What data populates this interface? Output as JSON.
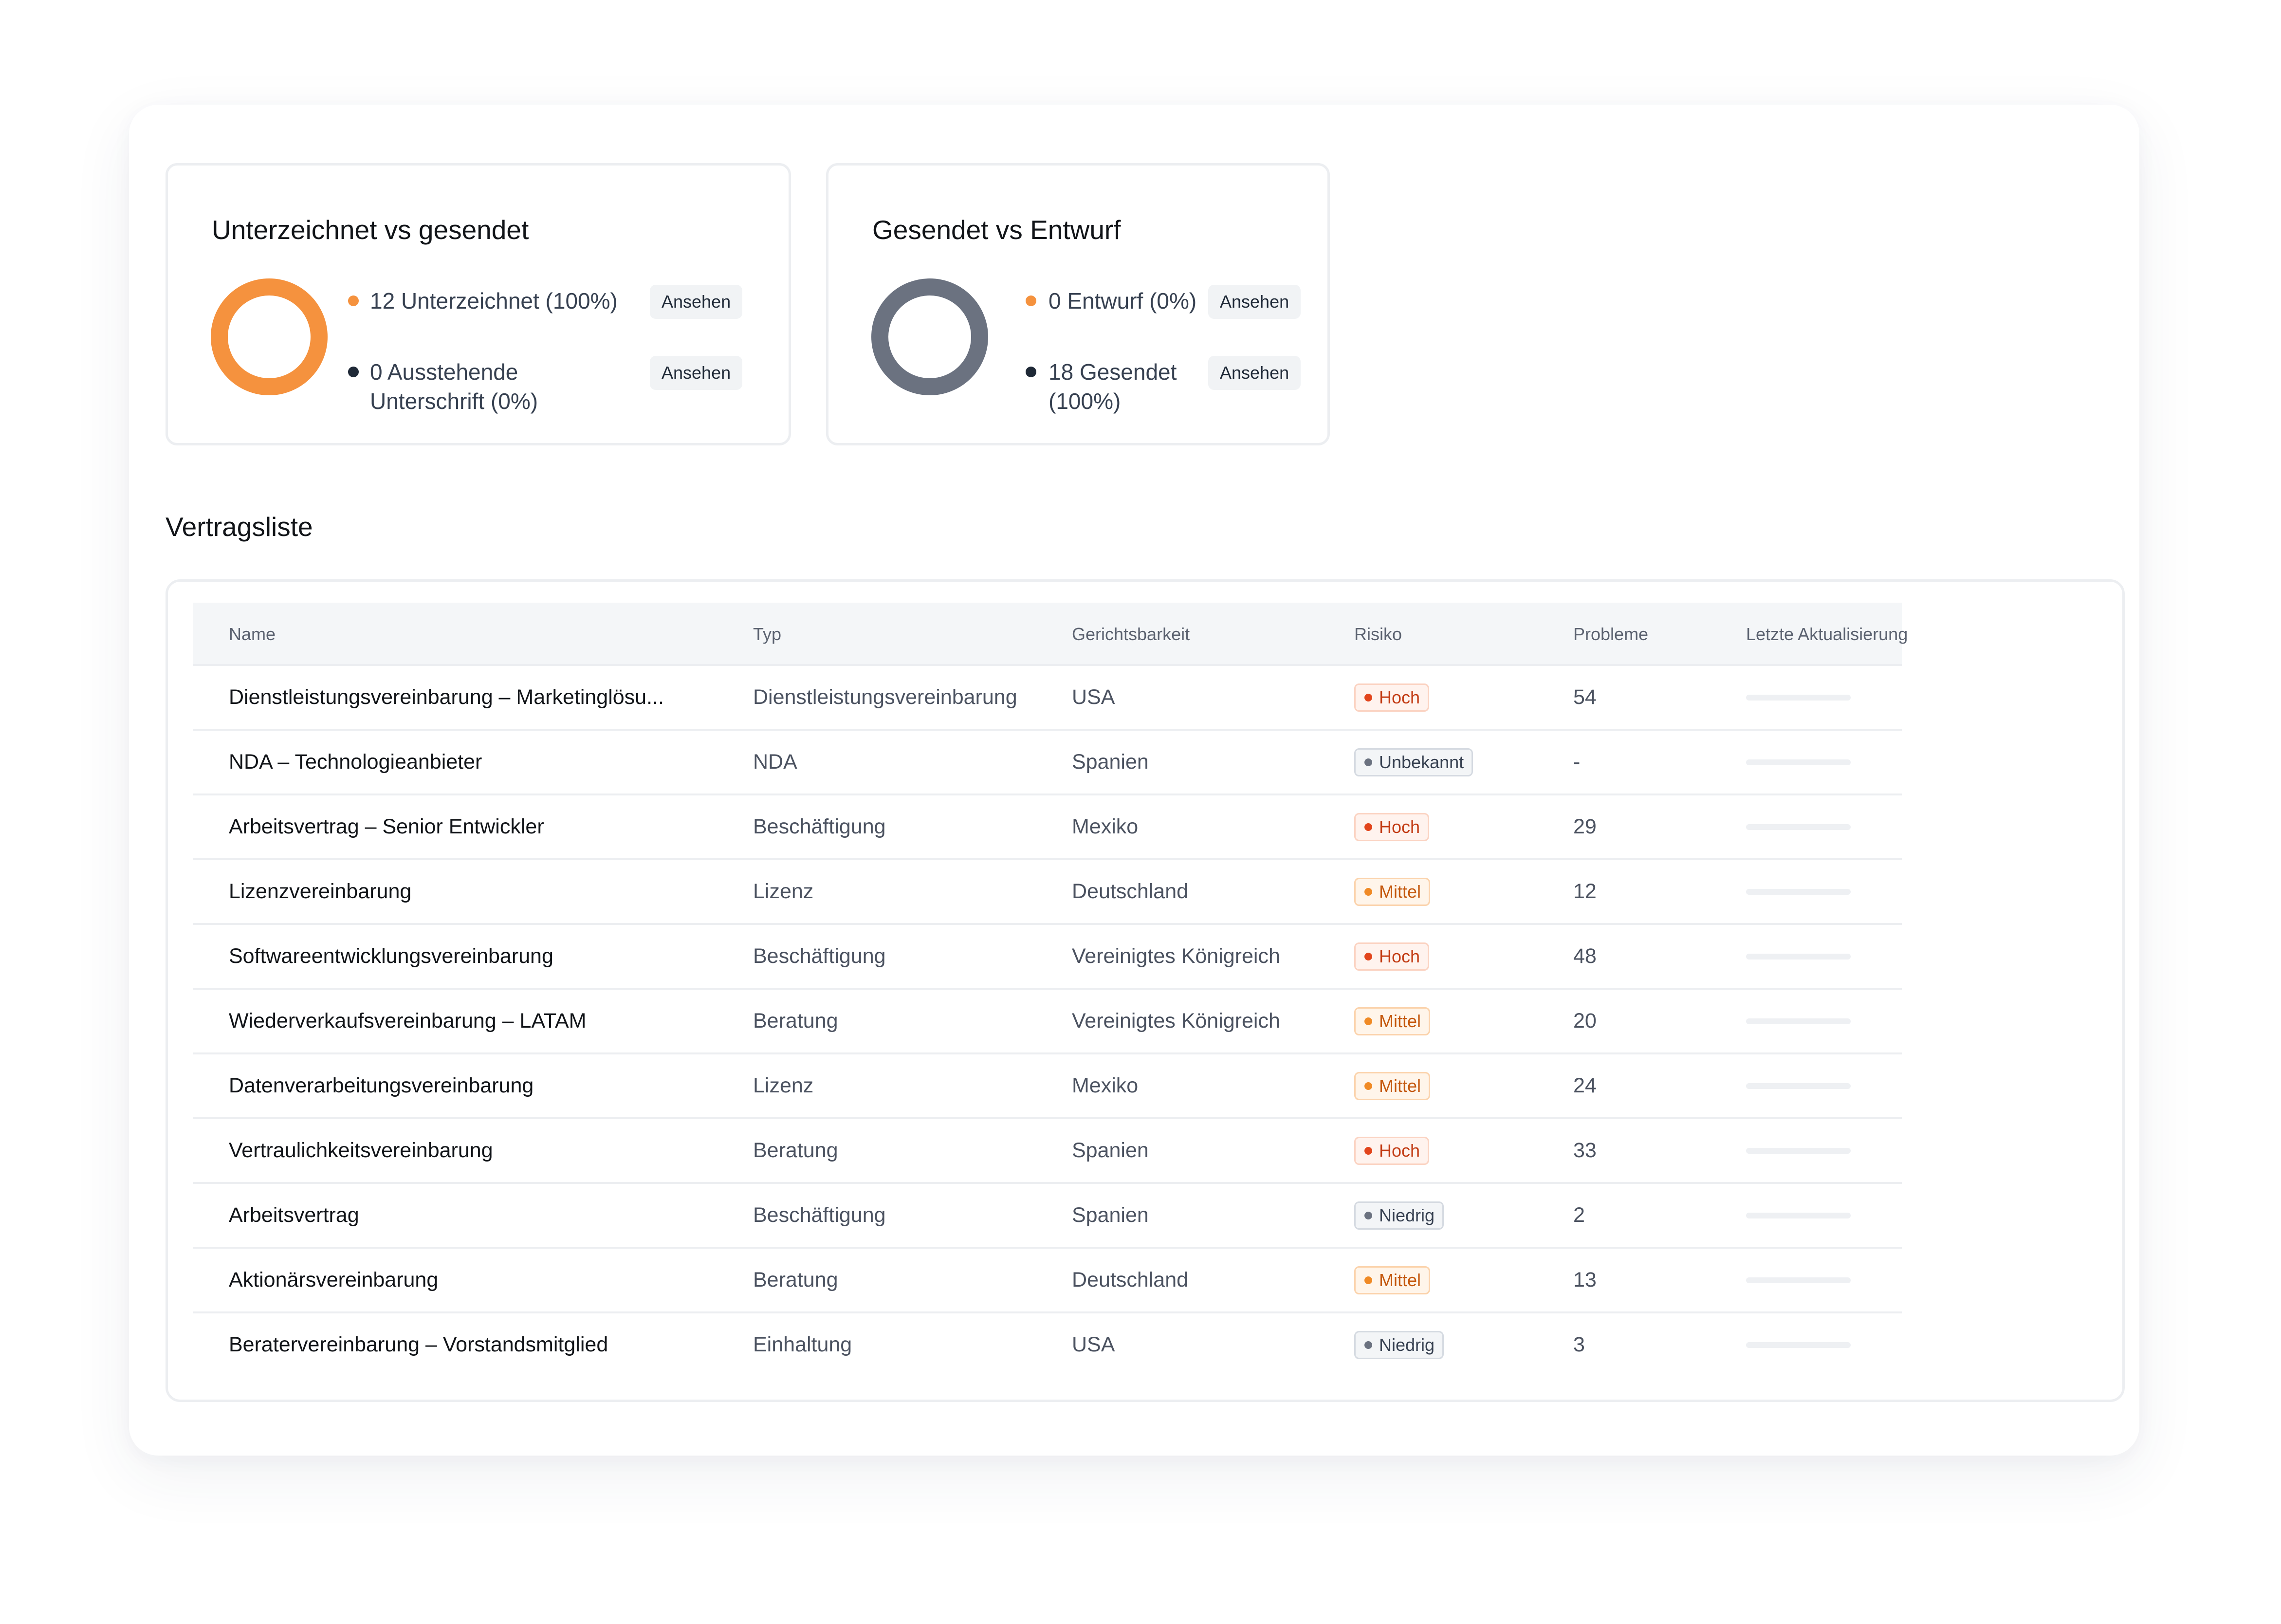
{
  "colors": {
    "accent_orange": "#f5923e",
    "gray_donut": "#6b7280",
    "dark_dot": "#1f2937",
    "risk_high": "#e2451c",
    "risk_medium": "#f08a25",
    "risk_neutral": "#6b7280"
  },
  "card_signed": {
    "title": "Unterzeichnet vs gesendet",
    "legend": [
      {
        "text": "12 Unterzeichnet (100%)",
        "button": "Ansehen",
        "color": "#f5923e"
      },
      {
        "text_line1": "0 Ausstehende",
        "text_line2": "Unterschrift (0%)",
        "button": "Ansehen",
        "color": "#1f2937"
      }
    ]
  },
  "card_sent": {
    "title": "Gesendet vs Entwurf",
    "legend": [
      {
        "text": "0 Entwurf (0%)",
        "button": "Ansehen",
        "color": "#f5923e"
      },
      {
        "text_line1": "18 Gesendet",
        "text_line2": "(100%)",
        "button": "Ansehen",
        "color": "#1f2937"
      }
    ]
  },
  "contracts": {
    "title": "Vertragsliste",
    "columns": [
      "Name",
      "Typ",
      "Gerichtsbarkeit",
      "Risiko",
      "Probleme",
      "Letzte Aktualisierung"
    ],
    "rows": [
      {
        "name": "Dienstleistungsvereinbarung – Marketinglösu...",
        "type": "Dienstleistungsvereinbarung",
        "jurisdiction": "USA",
        "risk": "Hoch",
        "issues": "54"
      },
      {
        "name": "NDA – Technologieanbieter",
        "type": "NDA",
        "jurisdiction": "Spanien",
        "risk": "Unbekannt",
        "issues": "-"
      },
      {
        "name": "Arbeitsvertrag – Senior Entwickler",
        "type": "Beschäftigung",
        "jurisdiction": "Mexiko",
        "risk": "Hoch",
        "issues": "29"
      },
      {
        "name": "Lizenzvereinbarung",
        "type": "Lizenz",
        "jurisdiction": "Deutschland",
        "risk": "Mittel",
        "issues": "12"
      },
      {
        "name": "Softwareentwicklungsvereinbarung",
        "type": "Beschäftigung",
        "jurisdiction": "Vereinigtes Königreich",
        "risk": "Hoch",
        "issues": "48"
      },
      {
        "name": "Wiederverkaufsvereinbarung – LATAM",
        "type": "Beratung",
        "jurisdiction": "Vereinigtes Königreich",
        "risk": "Mittel",
        "issues": "20"
      },
      {
        "name": "Datenverarbeitungsvereinbarung",
        "type": "Lizenz",
        "jurisdiction": "Mexiko",
        "risk": "Mittel",
        "issues": "24"
      },
      {
        "name": "Vertraulichkeitsvereinbarung",
        "type": "Beratung",
        "jurisdiction": "Spanien",
        "risk": "Hoch",
        "issues": "33"
      },
      {
        "name": "Arbeitsvertrag",
        "type": "Beschäftigung",
        "jurisdiction": "Spanien",
        "risk": "Niedrig",
        "issues": "2"
      },
      {
        "name": "Aktionärsvereinbarung",
        "type": "Beratung",
        "jurisdiction": "Deutschland",
        "risk": "Mittel",
        "issues": "13"
      },
      {
        "name": "Beratervereinbarung – Vorstandsmitglied",
        "type": "Einhaltung",
        "jurisdiction": "USA",
        "risk": "Niedrig",
        "issues": "3"
      }
    ]
  }
}
